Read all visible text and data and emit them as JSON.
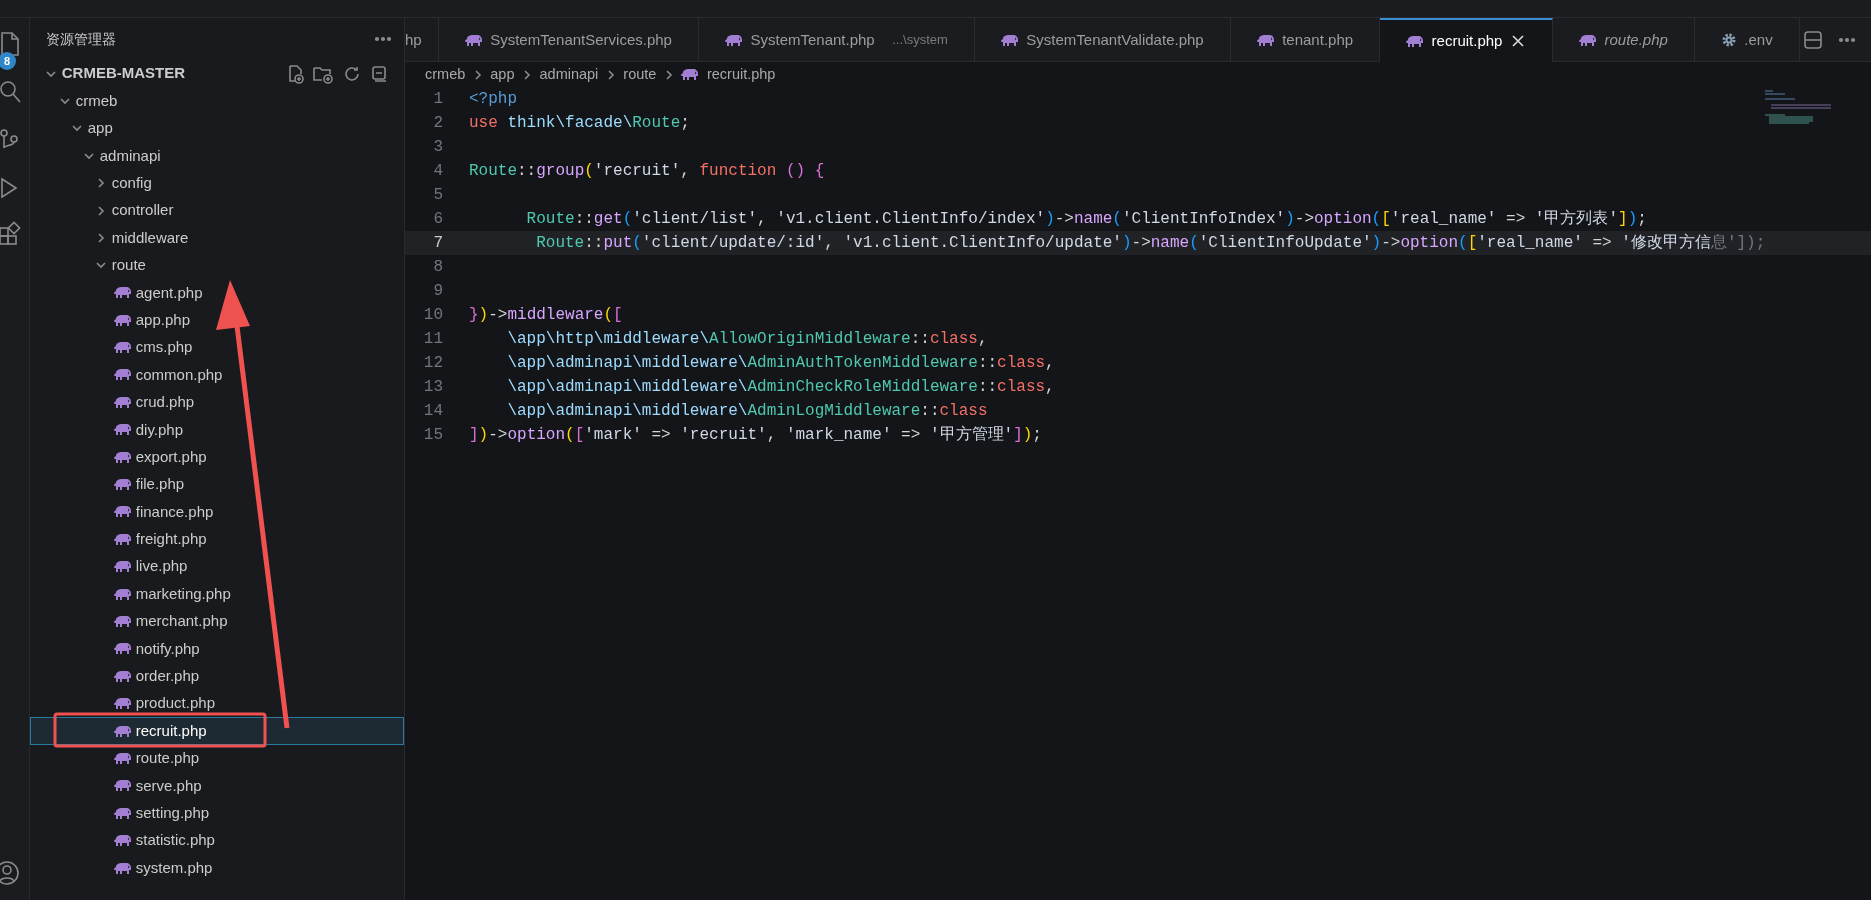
{
  "activity_bar": {
    "badge": "8"
  },
  "explorer": {
    "title": "资源管理器",
    "root": {
      "label": "CRMEB-MASTER",
      "kind": "folder",
      "expanded": true,
      "selected": false,
      "children": [
        {
          "label": "crmeb",
          "kind": "folder",
          "expanded": true,
          "selected": false,
          "children": [
            {
              "label": "app",
              "kind": "folder",
              "expanded": true,
              "selected": false,
              "children": [
                {
                  "label": "adminapi",
                  "kind": "folder",
                  "expanded": true,
                  "selected": false,
                  "children": [
                    {
                      "label": "config",
                      "kind": "folder",
                      "expanded": false,
                      "selected": false
                    },
                    {
                      "label": "controller",
                      "kind": "folder",
                      "expanded": false,
                      "selected": false
                    },
                    {
                      "label": "middleware",
                      "kind": "folder",
                      "expanded": false,
                      "selected": false
                    },
                    {
                      "label": "route",
                      "kind": "folder",
                      "expanded": true,
                      "selected": false,
                      "children": [
                        {
                          "label": "agent.php",
                          "kind": "file",
                          "selected": false
                        },
                        {
                          "label": "app.php",
                          "kind": "file",
                          "selected": false
                        },
                        {
                          "label": "cms.php",
                          "kind": "file",
                          "selected": false
                        },
                        {
                          "label": "common.php",
                          "kind": "file",
                          "selected": false
                        },
                        {
                          "label": "crud.php",
                          "kind": "file",
                          "selected": false
                        },
                        {
                          "label": "diy.php",
                          "kind": "file",
                          "selected": false
                        },
                        {
                          "label": "export.php",
                          "kind": "file",
                          "selected": false
                        },
                        {
                          "label": "file.php",
                          "kind": "file",
                          "selected": false
                        },
                        {
                          "label": "finance.php",
                          "kind": "file",
                          "selected": false
                        },
                        {
                          "label": "freight.php",
                          "kind": "file",
                          "selected": false
                        },
                        {
                          "label": "live.php",
                          "kind": "file",
                          "selected": false
                        },
                        {
                          "label": "marketing.php",
                          "kind": "file",
                          "selected": false
                        },
                        {
                          "label": "merchant.php",
                          "kind": "file",
                          "selected": false
                        },
                        {
                          "label": "notify.php",
                          "kind": "file",
                          "selected": false
                        },
                        {
                          "label": "order.php",
                          "kind": "file",
                          "selected": false
                        },
                        {
                          "label": "product.php",
                          "kind": "file",
                          "selected": false
                        },
                        {
                          "label": "recruit.php",
                          "kind": "file",
                          "selected": true
                        },
                        {
                          "label": "route.php",
                          "kind": "file",
                          "selected": false
                        },
                        {
                          "label": "serve.php",
                          "kind": "file",
                          "selected": false
                        },
                        {
                          "label": "setting.php",
                          "kind": "file",
                          "selected": false
                        },
                        {
                          "label": "statistic.php",
                          "kind": "file",
                          "selected": false
                        },
                        {
                          "label": "system.php",
                          "kind": "file",
                          "selected": false
                        }
                      ]
                    }
                  ]
                }
              ]
            }
          ]
        }
      ]
    }
  },
  "tabs": [
    {
      "label": "hp",
      "kind": "cut",
      "selected": false,
      "preview": false
    },
    {
      "label": "SystemTenantServices.php",
      "kind": "php",
      "selected": false,
      "preview": false
    },
    {
      "label": "SystemTenant.php",
      "description": "...\\system",
      "kind": "php",
      "selected": false,
      "preview": false
    },
    {
      "label": "SystemTenantValidate.php",
      "kind": "php",
      "selected": false,
      "preview": false
    },
    {
      "label": "tenant.php",
      "kind": "php",
      "selected": false,
      "preview": false
    },
    {
      "label": "recruit.php",
      "kind": "php",
      "selected": true,
      "preview": false
    },
    {
      "label": "route.php",
      "kind": "php",
      "selected": false,
      "preview": true
    },
    {
      "label": ".env",
      "kind": "config",
      "selected": false,
      "preview": false
    }
  ],
  "breadcrumb": [
    {
      "label": "crmeb",
      "kind": "folder"
    },
    {
      "label": "app",
      "kind": "folder"
    },
    {
      "label": "adminapi",
      "kind": "folder"
    },
    {
      "label": "route",
      "kind": "folder"
    },
    {
      "label": "recruit.php",
      "kind": "file"
    }
  ],
  "editor": {
    "lines": [
      {
        "number": "1",
        "current": false,
        "tokens": [
          {
            "kind": "kw",
            "text": "<?php"
          }
        ]
      },
      {
        "number": "2",
        "current": false,
        "tokens": [
          {
            "kind": "kw2",
            "text": "use"
          },
          {
            "kind": "ns",
            "text": " think\\facade\\"
          },
          {
            "kind": "cls",
            "text": "Route"
          },
          {
            "kind": "op",
            "text": ";"
          }
        ]
      },
      {
        "number": "3",
        "current": false
      },
      {
        "number": "4",
        "current": false,
        "tokens": [
          {
            "kind": "cls",
            "text": "Route"
          },
          {
            "kind": "op",
            "text": "::"
          },
          {
            "kind": "fn",
            "text": "group"
          },
          {
            "kind": "b1",
            "text": "("
          },
          {
            "kind": "str",
            "text": "'recruit'"
          },
          {
            "kind": "op",
            "text": ", "
          },
          {
            "kind": "kw2",
            "text": "function "
          },
          {
            "kind": "b2",
            "text": "() {"
          }
        ]
      },
      {
        "number": "5",
        "current": false
      },
      {
        "number": "6",
        "current": false,
        "tokens": [
          {
            "kind": "cls",
            "text": "      Route"
          },
          {
            "kind": "op",
            "text": "::"
          },
          {
            "kind": "fn",
            "text": "get"
          },
          {
            "kind": "b3",
            "text": "("
          },
          {
            "kind": "str",
            "text": "'client/list'"
          },
          {
            "kind": "op",
            "text": ", "
          },
          {
            "kind": "str",
            "text": "'v1.client.ClientInfo/index'"
          },
          {
            "kind": "b3",
            "text": ")"
          },
          {
            "kind": "op",
            "text": "->"
          },
          {
            "kind": "fn",
            "text": "name"
          },
          {
            "kind": "b3",
            "text": "("
          },
          {
            "kind": "str",
            "text": "'ClientInfoIndex'"
          },
          {
            "kind": "b3",
            "text": ")"
          },
          {
            "kind": "op",
            "text": "->"
          },
          {
            "kind": "fn",
            "text": "option"
          },
          {
            "kind": "b3",
            "text": "("
          },
          {
            "kind": "b1",
            "text": "["
          },
          {
            "kind": "str",
            "text": "'real_name'"
          },
          {
            "kind": "op",
            "text": " => "
          },
          {
            "kind": "str",
            "text": "'甲方列表'"
          },
          {
            "kind": "b1",
            "text": "]"
          },
          {
            "kind": "b3",
            "text": ")"
          },
          {
            "kind": "op",
            "text": ";"
          }
        ]
      },
      {
        "number": "7",
        "current": true,
        "tokens": [
          {
            "kind": "cls",
            "text": "       Route"
          },
          {
            "kind": "op",
            "text": "::"
          },
          {
            "kind": "fn",
            "text": "put"
          },
          {
            "kind": "b3",
            "text": "("
          },
          {
            "kind": "str",
            "text": "'client/update/:id'"
          },
          {
            "kind": "op",
            "text": ", "
          },
          {
            "kind": "str",
            "text": "'v1.client.ClientInfo/update'"
          },
          {
            "kind": "b3",
            "text": ")"
          },
          {
            "kind": "op",
            "text": "->"
          },
          {
            "kind": "fn",
            "text": "name"
          },
          {
            "kind": "b3",
            "text": "("
          },
          {
            "kind": "str",
            "text": "'ClientInfoUpdate'"
          },
          {
            "kind": "b3",
            "text": ")"
          },
          {
            "kind": "op",
            "text": "->"
          },
          {
            "kind": "fn",
            "text": "option"
          },
          {
            "kind": "b3",
            "text": "("
          },
          {
            "kind": "b1",
            "text": "["
          },
          {
            "kind": "str",
            "text": "'real_name'"
          },
          {
            "kind": "op",
            "text": " => "
          },
          {
            "kind": "str",
            "text": "'修改甲方信"
          },
          {
            "kind": "dim",
            "text": "息']);"
          }
        ]
      },
      {
        "number": "8",
        "current": false
      },
      {
        "number": "9",
        "current": false
      },
      {
        "number": "10",
        "current": false,
        "tokens": [
          {
            "kind": "b2",
            "text": "}"
          },
          {
            "kind": "b1",
            "text": ")"
          },
          {
            "kind": "op",
            "text": "->"
          },
          {
            "kind": "fn",
            "text": "middleware"
          },
          {
            "kind": "b1",
            "text": "("
          },
          {
            "kind": "b2",
            "text": "["
          }
        ]
      },
      {
        "number": "11",
        "current": false,
        "tokens": [
          {
            "kind": "ns",
            "text": "    \\app\\http\\middleware\\"
          },
          {
            "kind": "cls",
            "text": "AllowOriginMiddleware"
          },
          {
            "kind": "op",
            "text": "::"
          },
          {
            "kind": "kw2",
            "text": "class"
          },
          {
            "kind": "op",
            "text": ","
          }
        ]
      },
      {
        "number": "12",
        "current": false,
        "tokens": [
          {
            "kind": "ns",
            "text": "    \\app\\adminapi\\middleware\\"
          },
          {
            "kind": "cls",
            "text": "AdminAuthTokenMiddleware"
          },
          {
            "kind": "op",
            "text": "::"
          },
          {
            "kind": "kw2",
            "text": "class"
          },
          {
            "kind": "op",
            "text": ","
          }
        ]
      },
      {
        "number": "13",
        "current": false,
        "tokens": [
          {
            "kind": "ns",
            "text": "    \\app\\adminapi\\middleware\\"
          },
          {
            "kind": "cls",
            "text": "AdminCheckRoleMiddleware"
          },
          {
            "kind": "op",
            "text": "::"
          },
          {
            "kind": "kw2",
            "text": "class"
          },
          {
            "kind": "op",
            "text": ","
          }
        ]
      },
      {
        "number": "14",
        "current": false,
        "tokens": [
          {
            "kind": "ns",
            "text": "    \\app\\adminapi\\middleware\\"
          },
          {
            "kind": "cls",
            "text": "AdminLogMiddleware"
          },
          {
            "kind": "op",
            "text": "::"
          },
          {
            "kind": "kw2",
            "text": "class"
          }
        ]
      },
      {
        "number": "15",
        "current": false,
        "tokens": [
          {
            "kind": "b2",
            "text": "]"
          },
          {
            "kind": "b1",
            "text": ")"
          },
          {
            "kind": "op",
            "text": "->"
          },
          {
            "kind": "fn",
            "text": "option"
          },
          {
            "kind": "b1",
            "text": "("
          },
          {
            "kind": "b2",
            "text": "["
          },
          {
            "kind": "str",
            "text": "'mark'"
          },
          {
            "kind": "op",
            "text": " => "
          },
          {
            "kind": "str",
            "text": "'recruit'"
          },
          {
            "kind": "op",
            "text": ", "
          },
          {
            "kind": "str",
            "text": "'mark_name'"
          },
          {
            "kind": "op",
            "text": " => "
          },
          {
            "kind": "str",
            "text": "'甲方管理'"
          },
          {
            "kind": "b2",
            "text": "]"
          },
          {
            "kind": "b1",
            "text": ")"
          },
          {
            "kind": "op",
            "text": ";"
          }
        ]
      }
    ]
  }
}
